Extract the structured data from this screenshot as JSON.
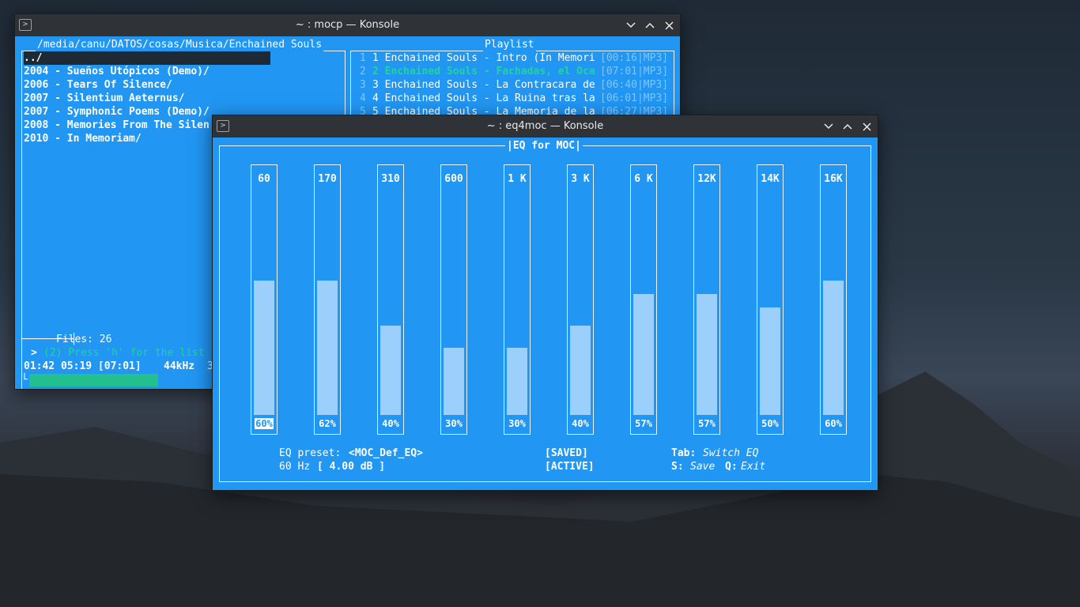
{
  "mocp": {
    "title": "~ : mocp — Konsole",
    "path": "/media/canu/DATOS/cosas/Musica/Enchained Souls",
    "files": [
      "../",
      "2004 - Sueños Utópicos (Demo)/",
      "2006 - Tears Of Silence/",
      "2007 - Silentium Aeternus/",
      "2007 - Symphonic Poems (Demo)/",
      "2008 - Memories From The Silen",
      "2010 - In Memoriam/"
    ],
    "files_count": "Files: 26",
    "prompt": ">",
    "message": "(2) Press 'h' for the list",
    "time_line": "01:42 05:19 [07:01]",
    "freq": "44kHz",
    "freq_extra": "3",
    "progress": 0.43,
    "playlist_title": "Playlist",
    "playlist": [
      {
        "num": "1",
        "title": "1 Enchained Souls - Intro (In Memori",
        "time": "[00:16|MP3]",
        "current": false
      },
      {
        "num": "2",
        "title": "2 Enchained Souls - Fachadas, el Oca",
        "time": "[07:01|MP3]",
        "current": true
      },
      {
        "num": "3",
        "title": "3 Enchained Souls - La Contracara de",
        "time": "[06:40|MP3]",
        "current": false
      },
      {
        "num": "4",
        "title": "4 Enchained Souls - La Ruina tras la",
        "time": "[06:01|MP3]",
        "current": false
      },
      {
        "num": "5",
        "title": "5 Enchained Souls - La Memoria de la",
        "time": "[06:27|MP3]",
        "current": false
      }
    ]
  },
  "eq": {
    "title": "~ : eq4moc — Konsole",
    "frame_title": "|EQ for MOC|",
    "bands": [
      {
        "label": "60",
        "pct": "60%",
        "level": 0.6,
        "selected": true
      },
      {
        "label": "170",
        "pct": "62%",
        "level": 0.6,
        "selected": false
      },
      {
        "label": "310",
        "pct": "40%",
        "level": 0.4,
        "selected": false
      },
      {
        "label": "600",
        "pct": "30%",
        "level": 0.3,
        "selected": false
      },
      {
        "label": "1 K",
        "pct": "30%",
        "level": 0.3,
        "selected": false
      },
      {
        "label": "3 K",
        "pct": "40%",
        "level": 0.4,
        "selected": false
      },
      {
        "label": "6 K",
        "pct": "57%",
        "level": 0.54,
        "selected": false
      },
      {
        "label": "12K",
        "pct": "57%",
        "level": 0.54,
        "selected": false
      },
      {
        "label": "14K",
        "pct": "50%",
        "level": 0.48,
        "selected": false
      },
      {
        "label": "16K",
        "pct": "60%",
        "level": 0.6,
        "selected": false
      }
    ],
    "preset_label": "EQ preset:",
    "preset_value": "<MOC_Def_EQ>",
    "hz_label": "60 Hz",
    "db_value": "[ 4.00 dB ]",
    "saved": "[SAVED]",
    "active": "[ACTIVE]",
    "tab_key": "Tab:",
    "tab_action": "Switch EQ",
    "save_key": "S:",
    "save_action": "Save",
    "quit_key": "Q:",
    "quit_action": "Exit"
  },
  "colors": {
    "terminal_bg": "#2196f3",
    "titlebar": "#2f3338",
    "bar_fill": "#9ad0fb",
    "accent_green": "#21d49a"
  }
}
